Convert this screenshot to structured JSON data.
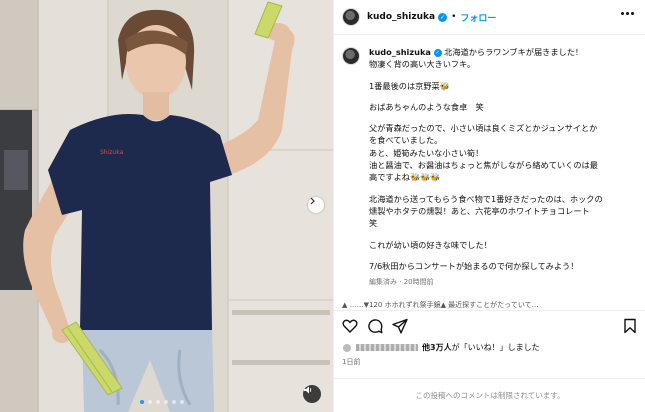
{
  "post": {
    "username": "kudo_shizuka",
    "separator": "•",
    "follow_label": "フォロー",
    "caption_lines": [
      "北海道からラワンブキが届きました！",
      "物凄く背の高い大きいフキ。",
      "",
      "1番最後のは京野菜🐝",
      "",
      "おばあちゃんのような食卓　笑",
      "",
      "父が青森だったので、小さい頃は良くミズとかジュンサイとか",
      "を食べていました。",
      "あと、姫筍みたいな小さい筍！",
      "油と醤油で、お醤油はちょっと焦がしながら絡めていくのは最",
      "高ですよね🐝🐝🐝",
      "",
      "北海道から送ってもらう食べ物で1番好きだったのは、ホックの",
      "燻製やホタテの燻製！あと、六花亭のホワイトチョコレート",
      "笑",
      "",
      "これが幼い頃の好きな味でした！",
      "",
      "7/6秋田からコンサートが始まるので何か探してみよう！"
    ],
    "caption_meta": "編集済み · 20時間前",
    "comment_peek": "▲ ……▼120 ホホれずれ祭手鏡▲ 最近探すことがたっていて…",
    "likes_text": "他3万人が「いいね！」しました",
    "likes_bold": "他3万人",
    "date": "1日前",
    "comments_closed": "この投稿へのコメントは制限されています。"
  },
  "media": {
    "slide_count": 6,
    "active_slide": 0
  },
  "colors": {
    "accent": "#0095f6",
    "shirt": "#1d2a4d",
    "rhubarb": "#cbd96a"
  }
}
